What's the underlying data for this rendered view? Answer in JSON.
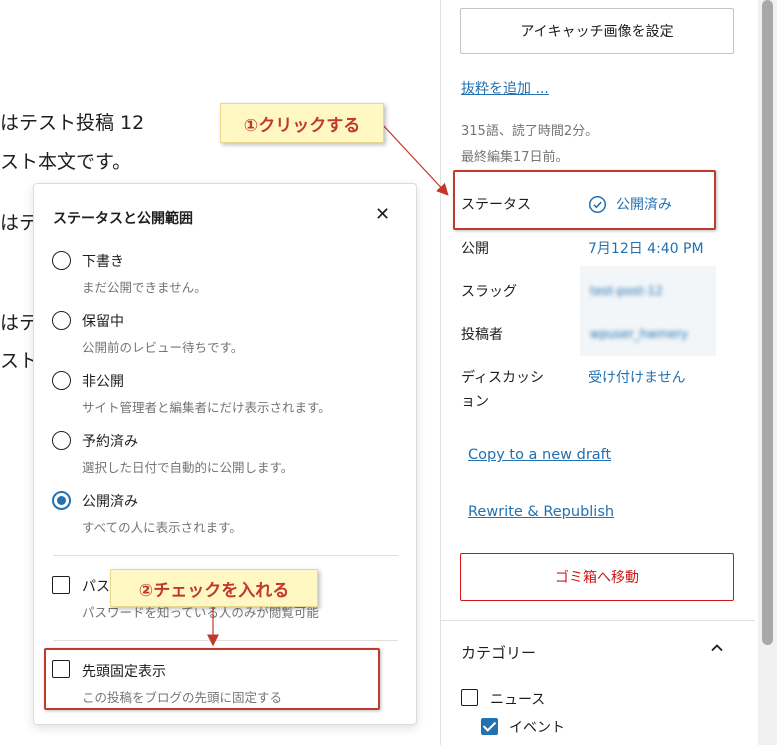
{
  "editor": {
    "lines": [
      "はテスト投稿 12",
      "スト本文です。",
      "はテ",
      "はテ",
      "スト"
    ]
  },
  "sidebar": {
    "featured_image_button": "アイキャッチ画像を設定",
    "add_excerpt_link": "抜粋を追加 ...",
    "word_count": "315語、読了時間2分。",
    "last_edited": "最終編集17日前。",
    "rows": [
      {
        "label": "ステータス",
        "value": "公開済み"
      },
      {
        "label": "公開",
        "value": "7月12日 4:40 PM"
      },
      {
        "label": "スラッグ",
        "value": "test-post-12"
      },
      {
        "label": "投稿者",
        "value": "wpuser_hwmery"
      },
      {
        "label": "ディスカッション",
        "label_line2": "ョン",
        "label_line1": "ディスカッシ",
        "value": "受け付けません"
      }
    ],
    "copy_draft_link": "Copy to a new draft",
    "rewrite_link": "Rewrite & Republish",
    "trash_button": "ゴミ箱へ移動",
    "categories_title": "カテゴリー",
    "categories": [
      {
        "label": "ニュース",
        "checked": false
      },
      {
        "label": "イベント",
        "checked": true
      }
    ]
  },
  "popover": {
    "title": "ステータスと公開範囲",
    "close_symbol": "✕",
    "options": [
      {
        "label": "下書き",
        "help": "まだ公開できません。",
        "checked": false
      },
      {
        "label": "保留中",
        "help": "公開前のレビュー待ちです。",
        "checked": false
      },
      {
        "label": "非公開",
        "help": "サイト管理者と編集者にだけ表示されます。",
        "checked": false
      },
      {
        "label": "予約済み",
        "help": "選択した日付で自動的に公開します。",
        "checked": false
      },
      {
        "label": "公開済み",
        "help": "すべての人に表示されます。",
        "checked": true
      }
    ],
    "password_label": "パス",
    "password_help": "パスワードを知っている人のみが閲覧可能",
    "sticky_label": "先頭固定表示",
    "sticky_help": "この投稿をブログの先頭に固定する"
  },
  "annotations": {
    "callout1": "①クリックする",
    "callout2": "②チェックを入れる",
    "color": "#c0392b"
  },
  "colors": {
    "accent": "#2271b1",
    "danger": "#cc1818",
    "callout_bg": "#fff8c4"
  }
}
